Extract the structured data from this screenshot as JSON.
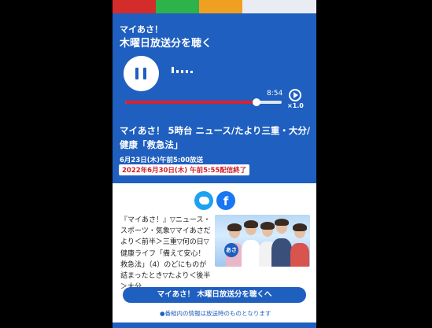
{
  "player": {
    "program_label": "マイあさ！",
    "subtitle": "木曜日放送分を聴く",
    "time_remaining": "8:54",
    "progress_fraction": 0.84,
    "speed": "×1.0",
    "pause_icon": "pause-icon"
  },
  "episode": {
    "title": "マイあさ！ 5時台 ニュース/たより三重・大分/健康「救急法」",
    "broadcast_date": "6月23日(木)午前5:00放送",
    "end_notice": "2022年6月30日(木) 午前5:55配信終了"
  },
  "share": {
    "twitter_icon": "twitter-icon",
    "facebook_label": "f"
  },
  "content": {
    "description": "『マイあさ！』▽ニュース・スポーツ・気象▽マイあさだより＜前半＞三重▽何の日▽健康ライフ「備えて安心！救急法」（4）のどにものが詰まったとき▽たより＜後半＞大分",
    "photo_logo": "あさ",
    "listen_button": "マイあさ！ 木曜日放送分を聴くへ",
    "note": "●番組内の情報は放送時のものとなります"
  },
  "colors": {
    "brand_blue": "#1f5fbf",
    "progress_red": "#d9232e",
    "ended_red": "#d1212d"
  }
}
